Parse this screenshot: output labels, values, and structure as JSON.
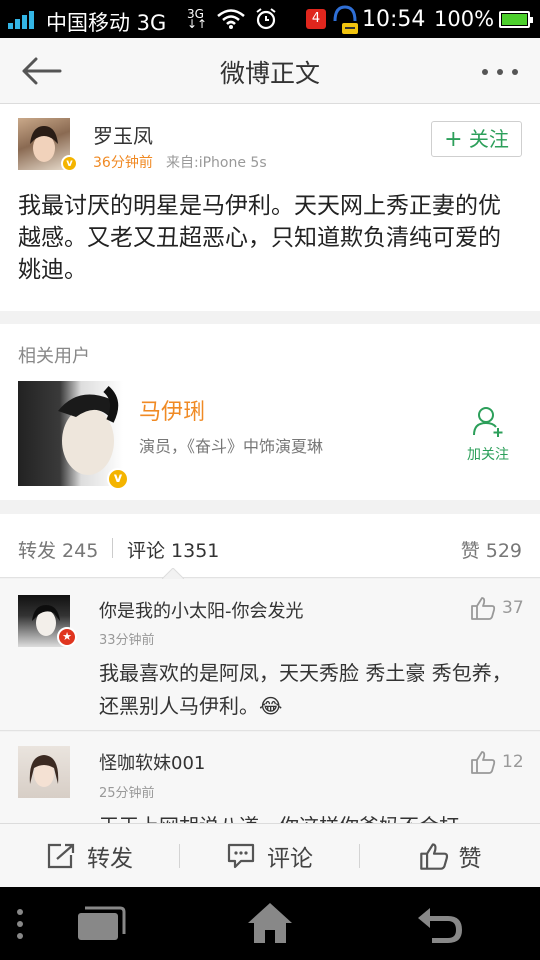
{
  "status_bar": {
    "carrier": "中国移动 3G",
    "notification_count": "4",
    "time": "10:54",
    "battery": "100%"
  },
  "header": {
    "title": "微博正文"
  },
  "post": {
    "author": "罗玉凤",
    "time": "36分钟前",
    "source": "来自:iPhone 5s",
    "follow_label": "关注",
    "text": "我最讨厌的明星是马伊利。天天网上秀正妻的优越感。又老又丑超恶心，只知道欺负清纯可爱的姚迪。"
  },
  "related_users": {
    "section_title": "相关用户",
    "name": "马伊琍",
    "description": "演员，《奋斗》中饰演夏琳",
    "follow_label": "加关注"
  },
  "stats_tabs": {
    "repost": "转发 245",
    "comments": "评论 1351",
    "likes": "赞 529"
  },
  "comments": [
    {
      "user": "你是我的小太阳-你会发光",
      "time": "33分钟前",
      "likes": "37",
      "text": "我最喜欢的是阿凤，天天秀脸 秀土豪 秀包养，还黑别人马伊利。😂"
    },
    {
      "user": "怪咖软妹001",
      "time": "25分钟前",
      "likes": "12",
      "text": "天天上网胡说八道，你这样你爸妈不会打"
    }
  ],
  "bottom_actions": {
    "repost": "转发",
    "comment": "评论",
    "like": "赞"
  },
  "colors": {
    "accent_orange": "#f08a24",
    "accent_green": "#2c9f5a",
    "status_blue": "#33b5e5"
  }
}
